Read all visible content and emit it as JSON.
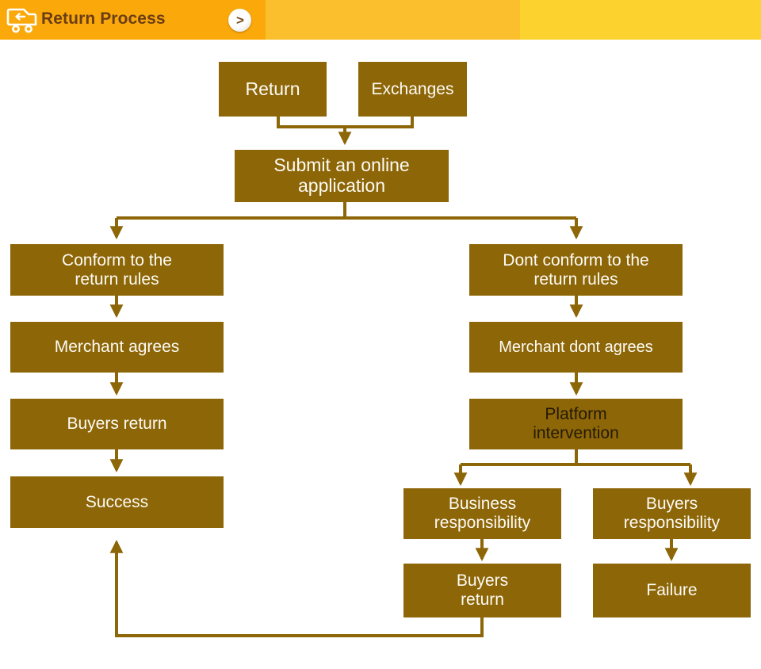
{
  "header": {
    "title": "Return Process",
    "truck_icon": "return-truck-icon",
    "next_label": ">",
    "colors": {
      "band_1": "#fba90a",
      "band_2": "#fbbe2c",
      "band_3": "#fbd22e",
      "title_text": "#6b3d16"
    }
  },
  "diagram": {
    "node_fill": "#8d6608",
    "node_text": "#fdfbf4",
    "connector_color": "#8d6608",
    "nodes": [
      {
        "id": "return",
        "label": "Return"
      },
      {
        "id": "exchanges",
        "label": "Exchanges"
      },
      {
        "id": "submit-application",
        "label": "Submit an online\napplication"
      },
      {
        "id": "conform-rules",
        "label": "Conform to the\nreturn rules"
      },
      {
        "id": "merchant-agrees",
        "label": "Merchant agrees"
      },
      {
        "id": "buyers-return-left",
        "label": "Buyers return"
      },
      {
        "id": "success",
        "label": "Success"
      },
      {
        "id": "dont-conform-rules",
        "label": "Dont conform to the\nreturn rules"
      },
      {
        "id": "merchant-dont-agrees",
        "label": "Merchant dont agrees"
      },
      {
        "id": "platform-intervention",
        "label": "Platform\nintervention"
      },
      {
        "id": "business-responsibility",
        "label": "Business\nresponsibility"
      },
      {
        "id": "buyers-responsibility",
        "label": "Buyers\nresponsibility"
      },
      {
        "id": "buyers-return-right",
        "label": "Buyers\nreturn"
      },
      {
        "id": "failure",
        "label": "Failure"
      }
    ]
  }
}
